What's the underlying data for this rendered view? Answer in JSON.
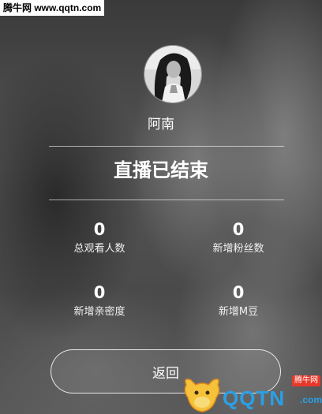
{
  "watermark_top": "腾牛网 www.qqtn.com",
  "profile": {
    "name": "阿南"
  },
  "title": "直播已结束",
  "stats": [
    {
      "value": "0",
      "label": "总观看人数"
    },
    {
      "value": "0",
      "label": "新增粉丝数"
    },
    {
      "value": "0",
      "label": "新增亲密度"
    },
    {
      "value": "0",
      "label": "新增M豆"
    }
  ],
  "back_button": "返回",
  "logo_watermark": {
    "tag": "腾牛网",
    "text": "QQTN",
    "suffix": ".com"
  },
  "colors": {
    "text": "#ffffff",
    "logo_blue": "#2aa0e6",
    "logo_red": "#e8382b"
  }
}
